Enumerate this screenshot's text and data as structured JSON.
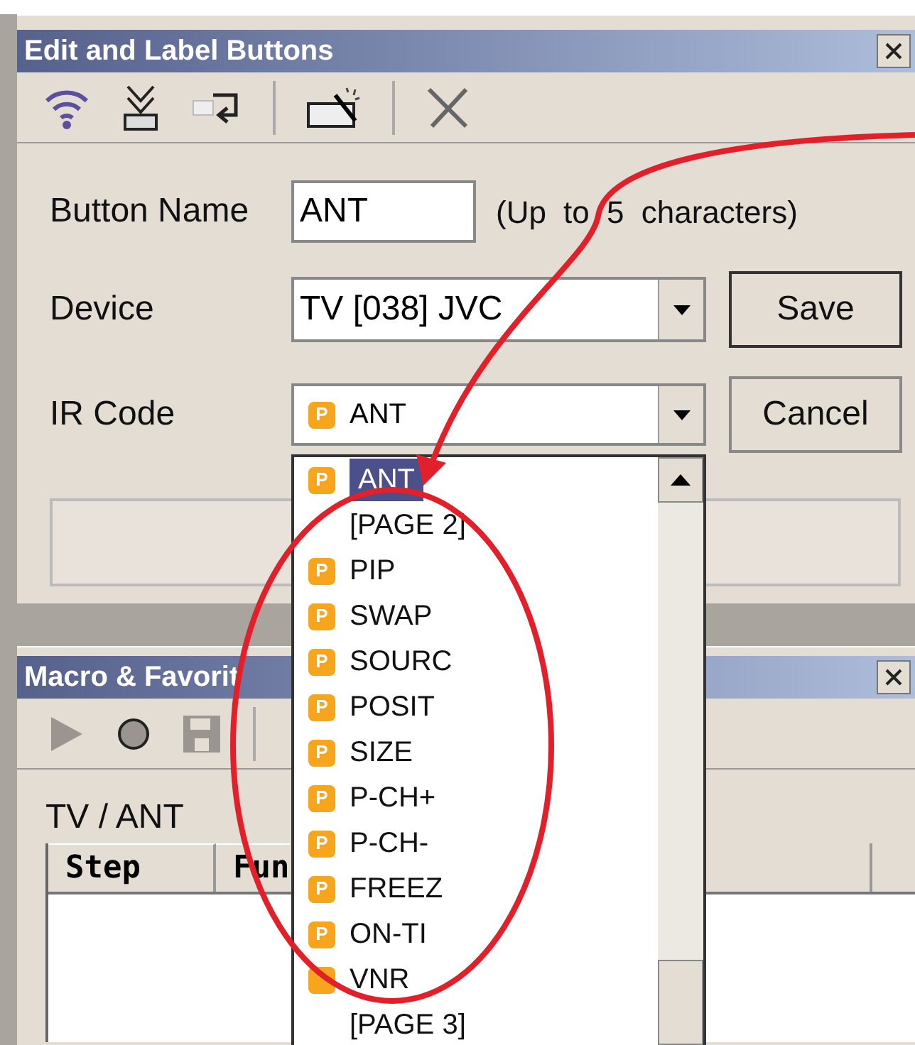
{
  "edit_window": {
    "title": "Edit and Label Buttons"
  },
  "form": {
    "button_name": {
      "label": "Button Name",
      "value": "ANT",
      "hint": "(Up to 5 characters)"
    },
    "device": {
      "label": "Device",
      "value": "TV [038] JVC"
    },
    "ir_code": {
      "label": "IR Code",
      "badge": "P",
      "value": "ANT"
    }
  },
  "buttons": [
    "Save",
    "Cancel"
  ],
  "ir_code_list": [
    {
      "kind": "code",
      "badge": "P",
      "label": "ANT",
      "selected": true
    },
    {
      "kind": "page",
      "label": "[PAGE 2]",
      "selected": false
    },
    {
      "kind": "code",
      "badge": "P",
      "label": "PIP",
      "selected": false
    },
    {
      "kind": "code",
      "badge": "P",
      "label": "SWAP",
      "selected": false
    },
    {
      "kind": "code",
      "badge": "P",
      "label": "SOURC",
      "selected": false
    },
    {
      "kind": "code",
      "badge": "P",
      "label": "POSIT",
      "selected": false
    },
    {
      "kind": "code",
      "badge": "P",
      "label": "SIZE",
      "selected": false
    },
    {
      "kind": "code",
      "badge": "P",
      "label": "P-CH+",
      "selected": false
    },
    {
      "kind": "code",
      "badge": "P",
      "label": "P-CH-",
      "selected": false
    },
    {
      "kind": "code",
      "badge": "P",
      "label": "FREEZ",
      "selected": false
    },
    {
      "kind": "code",
      "badge": "P",
      "label": "ON-TI",
      "selected": false
    },
    {
      "kind": "code",
      "label": "VNR",
      "selected": false
    },
    {
      "kind": "page",
      "label": "[PAGE 3]",
      "selected": false
    }
  ],
  "macro_window": {
    "title": "Macro & Favorit",
    "path": "TV / ANT",
    "columns": [
      "Step",
      "Fun"
    ]
  }
}
